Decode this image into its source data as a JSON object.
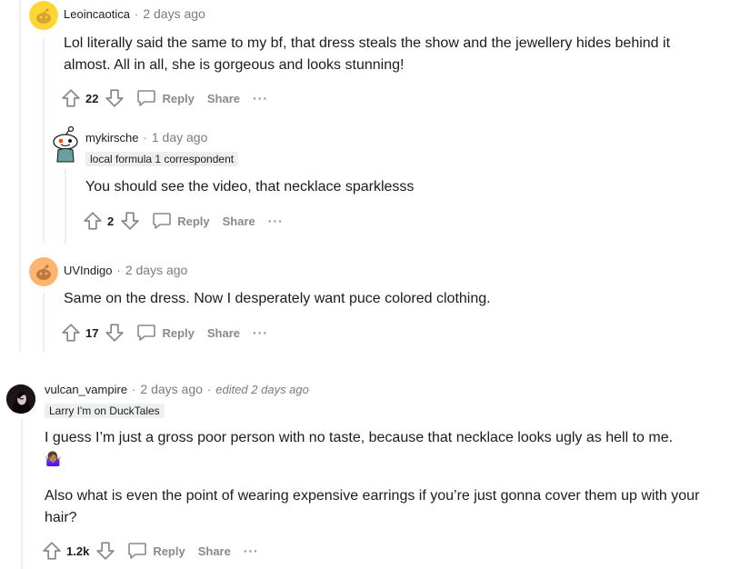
{
  "comments": [
    {
      "username": "Leoincaotica",
      "time": "2 days ago",
      "body": "Lol literally said the same to my bf, that dress steals the show and the jewellery hides behind it almost. All in all, she is gorgeous and looks stunning!",
      "score": "22",
      "reply_label": "Reply",
      "share_label": "Share",
      "more_label": "···",
      "avatar_color": "#ffd635"
    },
    {
      "username": "mykirsche",
      "time": "1 day ago",
      "flair": "local formula 1 correspondent",
      "body": "You should see the video, that necklace sparklesss",
      "score": "2",
      "reply_label": "Reply",
      "share_label": "Share",
      "more_label": "···"
    },
    {
      "username": "UVIndigo",
      "time": "2 days ago",
      "body": "Same on the dress. Now I desperately want puce colored clothing.",
      "score": "17",
      "reply_label": "Reply",
      "share_label": "Share",
      "more_label": "···",
      "avatar_color": "#ffb470"
    },
    {
      "username": "vulcan_vampire",
      "time": "2 days ago",
      "edited": "edited 2 days ago",
      "flair": "Larry I'm on DuckTales",
      "body_p1": "I guess I’m just a gross poor person with no taste, because that necklace looks ugly as hell to me.",
      "emoji": "🤷🏽‍♀️",
      "body_p2": "Also what is even the point of wearing expensive earrings if you’re just gonna cover them up with your hair?",
      "score": "1.2k",
      "reply_label": "Reply",
      "share_label": "Share",
      "more_label": "···"
    }
  ],
  "colors": {
    "text": "#1c1c1c",
    "meta": "#7c7c7c",
    "action": "#878a8c",
    "thread_line": "#edeff1"
  }
}
